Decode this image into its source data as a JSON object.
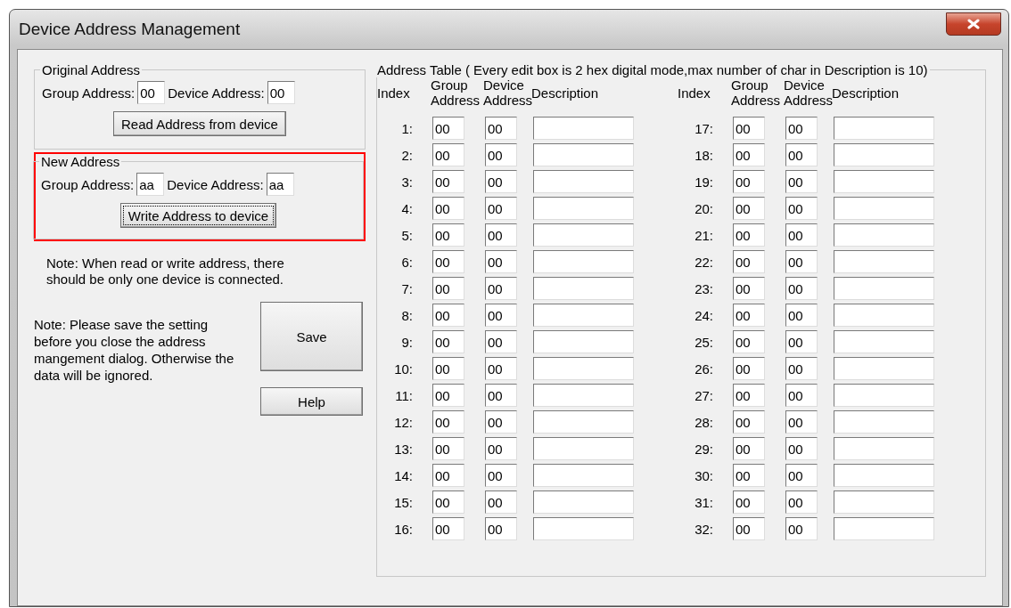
{
  "window": {
    "title": "Device Address Management"
  },
  "original_address": {
    "title": "Original Address",
    "group_label": "Group Address:",
    "group_value": "00",
    "device_label": "Device Address:",
    "device_value": "00",
    "button": {
      "label": "Read Address from device",
      "focused": false
    }
  },
  "new_address": {
    "title": "New Address",
    "highlighted": true,
    "group_label": "Group Address:",
    "group_value": "aa",
    "device_label": "Device Address:",
    "device_value": "aa",
    "button": {
      "label": "Write Address to device",
      "focused": true
    }
  },
  "notes": [
    "Note: When read or write address, there should be only one device is connected.",
    "Note: Please save the setting before you close the address mangement dialog. Otherwise the data will be ignored."
  ],
  "buttons": [
    "Save",
    "Help"
  ],
  "address_table": {
    "title": "Address Table ( Every edit box is 2 hex digital mode,max number of char in Description is 10)",
    "halves": [
      {
        "columns": [
          "Index",
          "Group Address",
          "Device Address",
          "Description"
        ],
        "rows": [
          {
            "index": "1:",
            "group": "00",
            "device": "00"
          },
          {
            "index": "2:",
            "group": "00",
            "device": "00"
          },
          {
            "index": "3:",
            "group": "00",
            "device": "00"
          },
          {
            "index": "4:",
            "group": "00",
            "device": "00"
          },
          {
            "index": "5:",
            "group": "00",
            "device": "00"
          },
          {
            "index": "6:",
            "group": "00",
            "device": "00"
          },
          {
            "index": "7:",
            "group": "00",
            "device": "00"
          },
          {
            "index": "8:",
            "group": "00",
            "device": "00"
          },
          {
            "index": "9:",
            "group": "00",
            "device": "00"
          },
          {
            "index": "10:",
            "group": "00",
            "device": "00"
          },
          {
            "index": "11:",
            "group": "00",
            "device": "00"
          },
          {
            "index": "12:",
            "group": "00",
            "device": "00"
          },
          {
            "index": "13:",
            "group": "00",
            "device": "00"
          },
          {
            "index": "14:",
            "group": "00",
            "device": "00"
          },
          {
            "index": "15:",
            "group": "00",
            "device": "00"
          },
          {
            "index": "16:",
            "group": "00",
            "device": "00"
          }
        ]
      },
      {
        "columns": [
          "Index",
          "Group Address",
          "Device Address",
          "Description"
        ],
        "rows": [
          {
            "index": "17:",
            "group": "00",
            "device": "00"
          },
          {
            "index": "18:",
            "group": "00",
            "device": "00"
          },
          {
            "index": "19:",
            "group": "00",
            "device": "00"
          },
          {
            "index": "20:",
            "group": "00",
            "device": "00"
          },
          {
            "index": "21:",
            "group": "00",
            "device": "00"
          },
          {
            "index": "22:",
            "group": "00",
            "device": "00"
          },
          {
            "index": "23:",
            "group": "00",
            "device": "00"
          },
          {
            "index": "24:",
            "group": "00",
            "device": "00"
          },
          {
            "index": "25:",
            "group": "00",
            "device": "00"
          },
          {
            "index": "26:",
            "group": "00",
            "device": "00"
          },
          {
            "index": "27:",
            "group": "00",
            "device": "00"
          },
          {
            "index": "28:",
            "group": "00",
            "device": "00"
          },
          {
            "index": "29:",
            "group": "00",
            "device": "00"
          },
          {
            "index": "30:",
            "group": "00",
            "device": "00"
          },
          {
            "index": "31:",
            "group": "00",
            "device": "00"
          },
          {
            "index": "32:",
            "group": "00",
            "device": "00"
          }
        ]
      }
    ]
  }
}
